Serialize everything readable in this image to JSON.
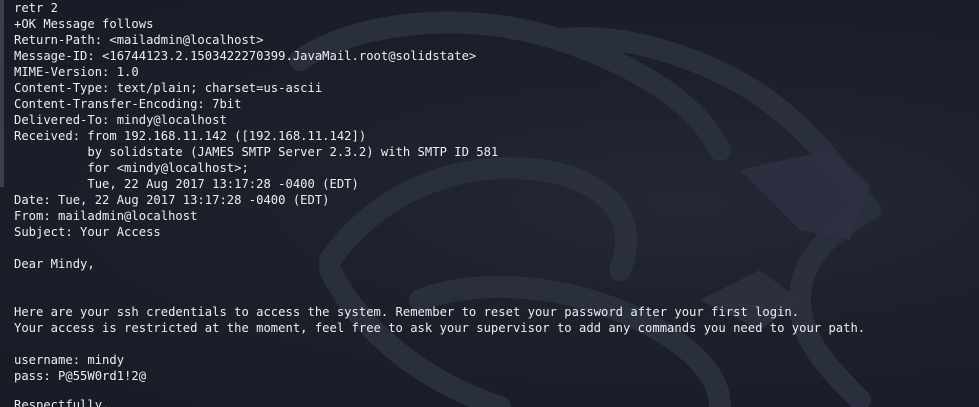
{
  "terminal": {
    "lines": [
      "retr 2",
      "+OK Message follows",
      "Return-Path: <mailadmin@localhost>",
      "Message-ID: <16744123.2.1503422270399.JavaMail.root@solidstate>",
      "MIME-Version: 1.0",
      "Content-Type: text/plain; charset=us-ascii",
      "Content-Transfer-Encoding: 7bit",
      "Delivered-To: mindy@localhost",
      "Received: from 192.168.11.142 ([192.168.11.142])",
      "          by solidstate (JAMES SMTP Server 2.3.2) with SMTP ID 581",
      "          for <mindy@localhost>;",
      "          Tue, 22 Aug 2017 13:17:28 -0400 (EDT)",
      "Date: Tue, 22 Aug 2017 13:17:28 -0400 (EDT)",
      "From: mailadmin@localhost",
      "Subject: Your Access",
      "",
      "Dear Mindy,",
      "",
      "",
      "Here are your ssh credentials to access the system. Remember to reset your password after your first login.",
      "Your access is restricted at the moment, feel free to ask your supervisor to add any commands you need to your path.",
      "",
      "username: mindy",
      "pass: P@55W0rd1!2@",
      "",
      "Respectfully,"
    ]
  },
  "colors": {
    "background": "#1b1e29",
    "text": "#eceef2",
    "watermark": "#2c3140"
  },
  "icons": {
    "background": "kali-dragon-icon"
  }
}
